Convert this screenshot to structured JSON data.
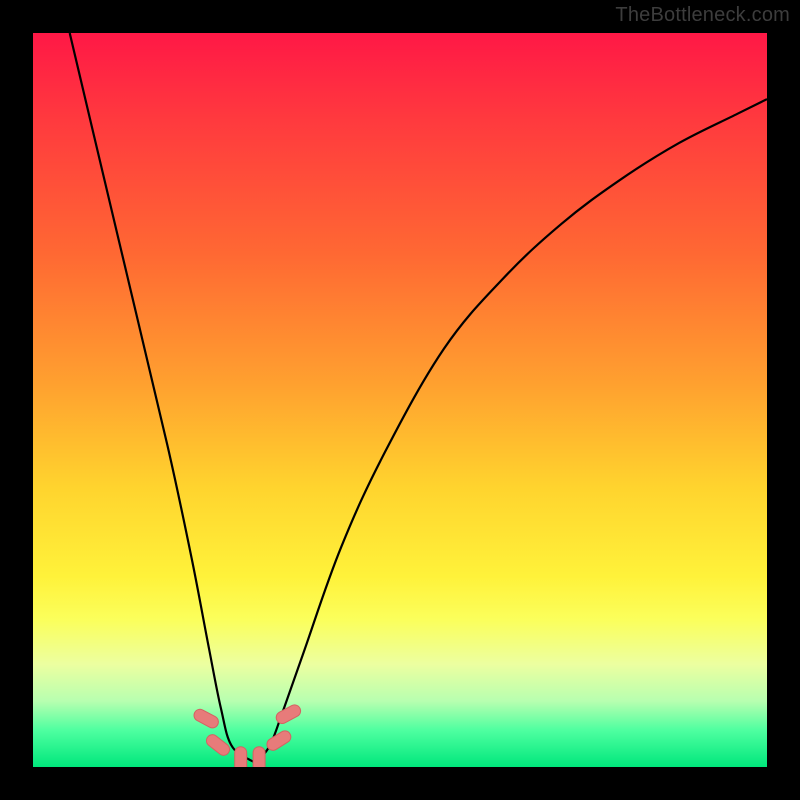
{
  "watermark": "TheBottleneck.com",
  "chart_data": {
    "type": "line",
    "title": "",
    "xlabel": "",
    "ylabel": "",
    "xlim": [
      0,
      1
    ],
    "ylim": [
      0,
      1
    ],
    "series": [
      {
        "name": "bottleneck-curve",
        "x": [
          0.05,
          0.095,
          0.14,
          0.185,
          0.217,
          0.24,
          0.256,
          0.27,
          0.295,
          0.306,
          0.323,
          0.34,
          0.37,
          0.42,
          0.48,
          0.56,
          0.64,
          0.72,
          0.8,
          0.88,
          0.96,
          1.0
        ],
        "y": [
          1.0,
          0.81,
          0.62,
          0.43,
          0.28,
          0.16,
          0.08,
          0.03,
          0.01,
          0.01,
          0.03,
          0.075,
          0.16,
          0.3,
          0.43,
          0.57,
          0.665,
          0.74,
          0.8,
          0.85,
          0.89,
          0.91
        ]
      }
    ],
    "pink_markers": {
      "description": "elongated rounded pink markers near the curve bottom",
      "points": [
        {
          "x": 0.236,
          "y": 0.066,
          "angle": -62
        },
        {
          "x": 0.252,
          "y": 0.03,
          "angle": -52
        },
        {
          "x": 0.283,
          "y": 0.01,
          "angle": 0
        },
        {
          "x": 0.308,
          "y": 0.01,
          "angle": 0
        },
        {
          "x": 0.335,
          "y": 0.036,
          "angle": 58
        },
        {
          "x": 0.348,
          "y": 0.072,
          "angle": 62
        }
      ]
    },
    "gradient_stops": [
      {
        "pos": 0.0,
        "color": "#ff1846"
      },
      {
        "pos": 0.12,
        "color": "#ff3a3e"
      },
      {
        "pos": 0.3,
        "color": "#ff6833"
      },
      {
        "pos": 0.48,
        "color": "#ffa12f"
      },
      {
        "pos": 0.62,
        "color": "#ffd42e"
      },
      {
        "pos": 0.74,
        "color": "#fff23a"
      },
      {
        "pos": 0.8,
        "color": "#fbff5c"
      },
      {
        "pos": 0.86,
        "color": "#ecffa0"
      },
      {
        "pos": 0.91,
        "color": "#b8ffb0"
      },
      {
        "pos": 0.95,
        "color": "#4effa0"
      },
      {
        "pos": 1.0,
        "color": "#00e77c"
      }
    ],
    "colors": {
      "curve": "#000000",
      "marker_fill": "#e77b7a",
      "marker_stroke": "#d46262",
      "background_frame": "#000000"
    }
  }
}
